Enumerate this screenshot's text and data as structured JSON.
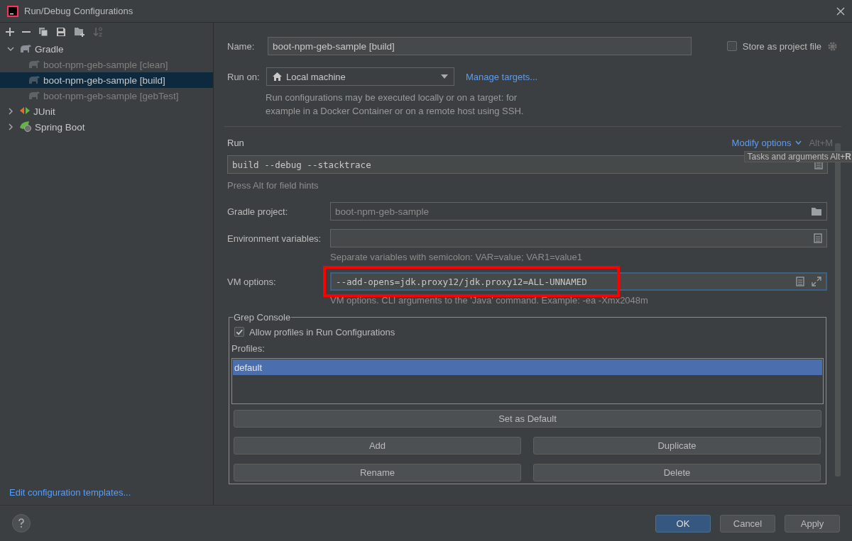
{
  "window": {
    "title": "Run/Debug Configurations"
  },
  "tree": [
    {
      "label": "Gradle",
      "kind": "gradle",
      "expanded": true,
      "selected": false,
      "children": [
        {
          "label": "boot-npm-geb-sample [clean]",
          "kind": "gradle",
          "temporary": true,
          "selected": false
        },
        {
          "label": "boot-npm-geb-sample [build]",
          "kind": "gradle",
          "temporary": true,
          "selected": true
        },
        {
          "label": "boot-npm-geb-sample [gebTest]",
          "kind": "gradle",
          "temporary": true,
          "selected": false
        }
      ]
    },
    {
      "label": "JUnit",
      "kind": "junit",
      "expanded": false,
      "selected": false
    },
    {
      "label": "Spring Boot",
      "kind": "spring",
      "expanded": false,
      "selected": false
    }
  ],
  "templates_link": "Edit configuration templates...",
  "name": {
    "label": "Name:",
    "value": "boot-npm-geb-sample [build]"
  },
  "store_as_project_file": {
    "label": "Store as project file",
    "checked": false
  },
  "run_on": {
    "label": "Run on:",
    "value": "Local machine",
    "link": "Manage targets...",
    "hint": "Run configurations may be executed locally or on a target: for example in a Docker Container or on a remote host using SSH."
  },
  "run": {
    "title": "Run",
    "modify_options": "Modify options",
    "shortcut": "Alt+M",
    "tooltip": "Tasks and arguments Alt+**R**",
    "command": "build --debug --stacktrace",
    "hint": "Press Alt for field hints"
  },
  "fields": [
    {
      "label": "Gradle project:",
      "value": "boot-npm-geb-sample",
      "kind": "folder",
      "disabled": true,
      "focused": false,
      "highlighted": false
    },
    {
      "label": "Environment variables:",
      "kind": "list",
      "hint": "Separate variables with semicolon: VAR=value; VAR1=value1",
      "focused": false,
      "highlighted": false
    },
    {
      "label": "VM options:",
      "value": "--add-opens=jdk.proxy12/jdk.proxy12=ALL-UNNAMED",
      "kind": "expand",
      "hint": "VM options. CLI arguments to the 'Java' command. Example: -ea -Xmx2048m",
      "focused": true,
      "highlighted": true
    }
  ],
  "grep_console": {
    "title": "Grep Console",
    "allow_profiles": {
      "label": "Allow profiles in Run Configurations",
      "checked": true
    },
    "profiles_label": "Profiles:",
    "profiles": [
      {
        "label": "default",
        "selected": true
      }
    ],
    "buttons": [
      {
        "label": "Set as Default",
        "kind": "wide"
      },
      {
        "label": "Add",
        "kind": "half"
      },
      {
        "label": "Duplicate",
        "kind": "half"
      },
      {
        "label": "Rename",
        "kind": "half"
      },
      {
        "label": "Delete",
        "kind": "half"
      }
    ]
  },
  "buttons": [
    {
      "label": "OK",
      "kind": "primary"
    },
    {
      "label": "Cancel",
      "kind": "normal"
    },
    {
      "label": "Apply",
      "kind": "normal"
    }
  ]
}
